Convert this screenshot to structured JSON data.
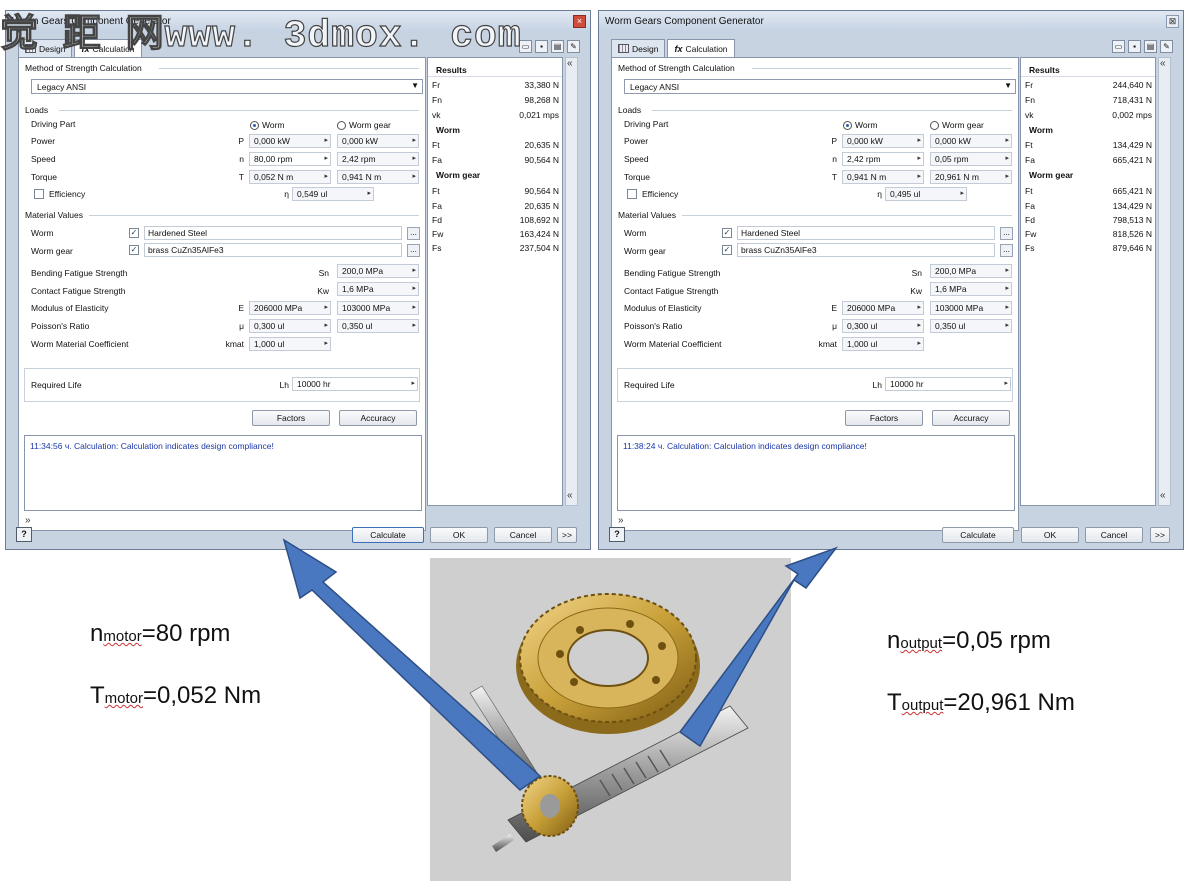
{
  "watermark": "觉 距 网www. 3dmox. com",
  "windows": [
    {
      "id": "w1",
      "title": "Worm Gears Component Generator",
      "close_glyph": "×",
      "tabs": [
        "Design",
        "Calculation"
      ],
      "method_label": "Method of Strength Calculation",
      "method_value": "Legacy ANSI",
      "loads_label": "Loads",
      "driving_part": "Driving Part",
      "radio_worm": "Worm",
      "radio_wormgear": "Worm gear",
      "rows": [
        {
          "label": "Power",
          "sym": "P",
          "a": "0,000 kW",
          "b": "0,000 kW"
        },
        {
          "label": "Speed",
          "sym": "n",
          "a": "80,00 rpm",
          "b": "2,42 rpm"
        },
        {
          "label": "Torque",
          "sym": "T",
          "a": "0,052 N m",
          "b": "0,941 N m"
        }
      ],
      "efficiency_label": "Efficiency",
      "eta": "η",
      "efficiency_value": "0,549 ul",
      "material_label": "Material Values",
      "mat_worm_label": "Worm",
      "mat_worm_value": "Hardened Steel",
      "mat_gear_label": "Worm gear",
      "mat_gear_value": "brass CuZn35AlFe3",
      "props": [
        {
          "label": "Bending Fatigue Strength",
          "sym": "Sn",
          "a": "",
          "b": "200,0 MPa"
        },
        {
          "label": "Contact Fatigue Strength",
          "sym": "Kw",
          "a": "",
          "b": "1,6 MPa"
        },
        {
          "label": "Modulus of Elasticity",
          "sym": "E",
          "a": "206000 MPa",
          "b": "103000 MPa"
        },
        {
          "label": "Poisson's Ratio",
          "sym": "μ",
          "a": "0,300 ul",
          "b": "0,350 ul"
        },
        {
          "label": "Worm Material Coefficient",
          "sym": "kmat",
          "a": "1,000 ul",
          "b": ""
        }
      ],
      "life_label": "Required Life",
      "life_sym": "Lh",
      "life_value": "10000 hr",
      "factors_btn": "Factors",
      "accuracy_btn": "Accuracy",
      "log": "11:34:56 ч. Calculation: Calculation indicates design compliance!",
      "calculate_btn": "Calculate",
      "ok_btn": "OK",
      "cancel_btn": "Cancel",
      "more_btn": ">>",
      "results_title": "Results",
      "results_top": [
        {
          "k": "Fr",
          "v": "33,380 N"
        },
        {
          "k": "Fn",
          "v": "98,268 N"
        },
        {
          "k": "vk",
          "v": "0,021 mps"
        }
      ],
      "worm_title": "Worm",
      "worm_results": [
        {
          "k": "Ft",
          "v": "20,635 N"
        },
        {
          "k": "Fa",
          "v": "90,564 N"
        }
      ],
      "gear_title": "Worm gear",
      "gear_results": [
        {
          "k": "Ft",
          "v": "90,564 N"
        },
        {
          "k": "Fa",
          "v": "20,635 N"
        },
        {
          "k": "Fd",
          "v": "108,692 N"
        },
        {
          "k": "Fw",
          "v": "163,424 N"
        },
        {
          "k": "Fs",
          "v": "237,504 N"
        }
      ]
    },
    {
      "id": "w2",
      "title": "Worm Gears Component Generator",
      "close_glyph": "⊠",
      "tabs": [
        "Design",
        "Calculation"
      ],
      "method_label": "Method of Strength Calculation",
      "method_value": "Legacy ANSI",
      "loads_label": "Loads",
      "driving_part": "Driving Part",
      "radio_worm": "Worm",
      "radio_wormgear": "Worm gear",
      "rows": [
        {
          "label": "Power",
          "sym": "P",
          "a": "0,000 kW",
          "b": "0,000 kW"
        },
        {
          "label": "Speed",
          "sym": "n",
          "a": "2,42 rpm",
          "b": "0,05 rpm"
        },
        {
          "label": "Torque",
          "sym": "T",
          "a": "0,941 N m",
          "b": "20,961 N m"
        }
      ],
      "efficiency_label": "Efficiency",
      "eta": "η",
      "efficiency_value": "0,495 ul",
      "material_label": "Material Values",
      "mat_worm_label": "Worm",
      "mat_worm_value": "Hardened Steel",
      "mat_gear_label": "Worm gear",
      "mat_gear_value": "brass CuZn35AlFe3",
      "props": [
        {
          "label": "Bending Fatigue Strength",
          "sym": "Sn",
          "a": "",
          "b": "200,0 MPa"
        },
        {
          "label": "Contact Fatigue Strength",
          "sym": "Kw",
          "a": "",
          "b": "1,6 MPa"
        },
        {
          "label": "Modulus of Elasticity",
          "sym": "E",
          "a": "206000 MPa",
          "b": "103000 MPa"
        },
        {
          "label": "Poisson's Ratio",
          "sym": "μ",
          "a": "0,300 ul",
          "b": "0,350 ul"
        },
        {
          "label": "Worm Material Coefficient",
          "sym": "kmat",
          "a": "1,000 ul",
          "b": ""
        }
      ],
      "life_label": "Required Life",
      "life_sym": "Lh",
      "life_value": "10000 hr",
      "factors_btn": "Factors",
      "accuracy_btn": "Accuracy",
      "log": "11:38:24 ч. Calculation: Calculation indicates design compliance!",
      "calculate_btn": "Calculate",
      "ok_btn": "OK",
      "cancel_btn": "Cancel",
      "more_btn": ">>",
      "results_title": "Results",
      "results_top": [
        {
          "k": "Fr",
          "v": "244,640 N"
        },
        {
          "k": "Fn",
          "v": "718,431 N"
        },
        {
          "k": "vk",
          "v": "0,002 mps"
        }
      ],
      "worm_title": "Worm",
      "worm_results": [
        {
          "k": "Ft",
          "v": "134,429 N"
        },
        {
          "k": "Fa",
          "v": "665,421 N"
        }
      ],
      "gear_title": "Worm gear",
      "gear_results": [
        {
          "k": "Ft",
          "v": "665,421 N"
        },
        {
          "k": "Fa",
          "v": "134,429 N"
        },
        {
          "k": "Fd",
          "v": "798,513 N"
        },
        {
          "k": "Fw",
          "v": "818,526 N"
        },
        {
          "k": "Fs",
          "v": "879,646 N"
        }
      ]
    }
  ],
  "annotations": {
    "n_motor_n": "n",
    "n_motor_sub": "motor",
    "n_motor_val": "=80 rpm",
    "t_motor_t": "T",
    "t_motor_sub": "motor",
    "t_motor_val": "=0,052 Nm",
    "n_out_n": "n",
    "n_out_sub": "output",
    "n_out_val": "=0,05 rpm",
    "t_out_t": "T",
    "t_out_sub": "output",
    "t_out_val": "=20,961 Nm"
  },
  "colors": {
    "arrow": "#4a78c0",
    "gear": "#c9a13a",
    "log_text": "#1b37a8"
  }
}
